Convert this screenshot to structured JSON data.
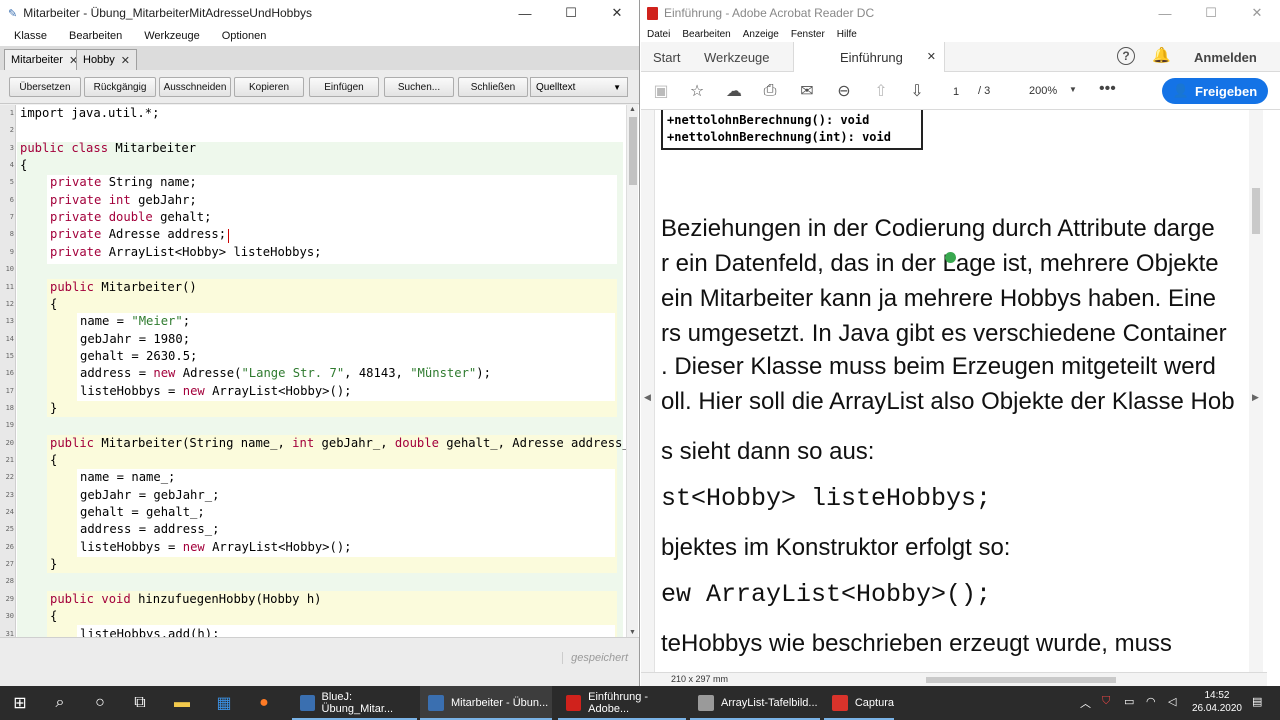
{
  "bluej": {
    "title": "Mitarbeiter - Übung_MitarbeiterMitAdresseUndHobbys",
    "menus": [
      "Klasse",
      "Bearbeiten",
      "Werkzeuge",
      "Optionen"
    ],
    "tabs": [
      {
        "label": "Mitarbeiter",
        "active": true
      },
      {
        "label": "Hobby",
        "active": false
      }
    ],
    "toolbar": {
      "compile": "Übersetzen",
      "undo": "Rückgängig",
      "cut": "Ausschneiden",
      "copy": "Kopieren",
      "paste": "Einfügen",
      "find": "Suchen...",
      "close": "Schließen",
      "view": "Quelltext"
    },
    "line_numbers": [
      "1",
      "2",
      "3",
      "4",
      "5",
      "6",
      "7",
      "8",
      "9",
      "10",
      "11",
      "12",
      "13",
      "14",
      "15",
      "16",
      "17",
      "18",
      "19",
      "20",
      "21",
      "22",
      "23",
      "24",
      "25",
      "26",
      "27",
      "28",
      "29",
      "30",
      "31"
    ],
    "code": [
      {
        "n": 1,
        "indent": 0,
        "parts": [
          {
            "t": "import java.util.*;",
            "c": ""
          }
        ]
      },
      {
        "n": 3,
        "indent": 0,
        "parts": [
          {
            "t": "public class ",
            "c": "kw"
          },
          {
            "t": "Mitarbeiter",
            "c": ""
          }
        ]
      },
      {
        "n": 4,
        "indent": 0,
        "parts": [
          {
            "t": "{",
            "c": ""
          }
        ]
      },
      {
        "n": 5,
        "indent": 1,
        "parts": [
          {
            "t": "private ",
            "c": "kw"
          },
          {
            "t": "String name;",
            "c": ""
          }
        ]
      },
      {
        "n": 6,
        "indent": 1,
        "parts": [
          {
            "t": "private int ",
            "c": "kw"
          },
          {
            "t": "gebJahr;",
            "c": ""
          }
        ]
      },
      {
        "n": 7,
        "indent": 1,
        "parts": [
          {
            "t": "private double ",
            "c": "kw"
          },
          {
            "t": "gehalt;",
            "c": ""
          }
        ]
      },
      {
        "n": 8,
        "indent": 1,
        "parts": [
          {
            "t": "private ",
            "c": "kw"
          },
          {
            "t": "Adresse address;",
            "c": ""
          }
        ]
      },
      {
        "n": 9,
        "indent": 1,
        "parts": [
          {
            "t": "private ",
            "c": "kw"
          },
          {
            "t": "ArrayList<Hobby> listeHobbys;",
            "c": ""
          }
        ]
      },
      {
        "n": 11,
        "indent": 1,
        "parts": [
          {
            "t": "public ",
            "c": "kw"
          },
          {
            "t": "Mitarbeiter()",
            "c": ""
          }
        ]
      },
      {
        "n": 12,
        "indent": 1,
        "parts": [
          {
            "t": "{",
            "c": ""
          }
        ]
      },
      {
        "n": 13,
        "indent": 2,
        "parts": [
          {
            "t": "name = ",
            "c": ""
          },
          {
            "t": "\"Meier\"",
            "c": "str"
          },
          {
            "t": ";",
            "c": ""
          }
        ]
      },
      {
        "n": 14,
        "indent": 2,
        "parts": [
          {
            "t": "gebJahr = 1980;",
            "c": ""
          }
        ]
      },
      {
        "n": 15,
        "indent": 2,
        "parts": [
          {
            "t": "gehalt = 2630.5;",
            "c": ""
          }
        ]
      },
      {
        "n": 16,
        "indent": 2,
        "parts": [
          {
            "t": "address = ",
            "c": ""
          },
          {
            "t": "new ",
            "c": "kw"
          },
          {
            "t": "Adresse(",
            "c": ""
          },
          {
            "t": "\"Lange Str. 7\"",
            "c": "str"
          },
          {
            "t": ", 48143, ",
            "c": ""
          },
          {
            "t": "\"Münster\"",
            "c": "str"
          },
          {
            "t": ");",
            "c": ""
          }
        ]
      },
      {
        "n": 17,
        "indent": 2,
        "parts": [
          {
            "t": "listeHobbys = ",
            "c": ""
          },
          {
            "t": "new ",
            "c": "kw"
          },
          {
            "t": "ArrayList<Hobby>();",
            "c": ""
          }
        ]
      },
      {
        "n": 18,
        "indent": 1,
        "parts": [
          {
            "t": "}",
            "c": ""
          }
        ]
      },
      {
        "n": 20,
        "indent": 1,
        "parts": [
          {
            "t": "public ",
            "c": "kw"
          },
          {
            "t": "Mitarbeiter(String name_, ",
            "c": ""
          },
          {
            "t": "int ",
            "c": "kw"
          },
          {
            "t": "gebJahr_, ",
            "c": ""
          },
          {
            "t": "double ",
            "c": "kw"
          },
          {
            "t": "gehalt_, Adresse address_",
            "c": ""
          }
        ]
      },
      {
        "n": 21,
        "indent": 1,
        "parts": [
          {
            "t": "{",
            "c": ""
          }
        ]
      },
      {
        "n": 22,
        "indent": 2,
        "parts": [
          {
            "t": "name = name_;",
            "c": ""
          }
        ]
      },
      {
        "n": 23,
        "indent": 2,
        "parts": [
          {
            "t": "gebJahr = gebJahr_;",
            "c": ""
          }
        ]
      },
      {
        "n": 24,
        "indent": 2,
        "parts": [
          {
            "t": "gehalt = gehalt_;",
            "c": ""
          }
        ]
      },
      {
        "n": 25,
        "indent": 2,
        "parts": [
          {
            "t": "address = address_;",
            "c": ""
          }
        ]
      },
      {
        "n": 26,
        "indent": 2,
        "parts": [
          {
            "t": "listeHobbys = ",
            "c": ""
          },
          {
            "t": "new ",
            "c": "kw"
          },
          {
            "t": "ArrayList<Hobby>();",
            "c": ""
          }
        ]
      },
      {
        "n": 27,
        "indent": 1,
        "parts": [
          {
            "t": "}",
            "c": ""
          }
        ]
      },
      {
        "n": 29,
        "indent": 1,
        "parts": [
          {
            "t": "public void ",
            "c": "kw"
          },
          {
            "t": "hinzufuegenHobby(Hobby h)",
            "c": ""
          }
        ]
      },
      {
        "n": 30,
        "indent": 1,
        "parts": [
          {
            "t": "{",
            "c": ""
          }
        ]
      },
      {
        "n": 31,
        "indent": 2,
        "parts": [
          {
            "t": "listeHobbys.add(h);",
            "c": ""
          }
        ]
      }
    ],
    "status": "gespeichert"
  },
  "acrobat": {
    "title": "Einführung - Adobe Acrobat Reader DC",
    "menus": [
      "Datei",
      "Bearbeiten",
      "Anzeige",
      "Fenster",
      "Hilfe"
    ],
    "tabs": {
      "start": "Start",
      "tools": "Werkzeuge",
      "doc": "Einführung"
    },
    "signin": "Anmelden",
    "page_current": "1",
    "page_total": "/ 3",
    "zoom": "200%",
    "share": "Freigeben",
    "uml": [
      "+nettolohnBerechnung(): void",
      "+nettolohnBerechnung(int): void"
    ],
    "lines": [
      {
        "text": "Beziehungen in der Codierung durch Attribute darge",
        "mono": false
      },
      {
        "text": "r ein Datenfeld, das in der Lage ist, mehrere Objekte",
        "mono": false
      },
      {
        "text": "ein Mitarbeiter kann ja mehrere Hobbys haben. Eine",
        "mono": false
      },
      {
        "text": "rs umgesetzt. In Java gibt es verschiedene Container",
        "mono": false
      },
      {
        "text": ". Dieser Klasse muss beim Erzeugen mitgeteilt werd",
        "mono": false
      },
      {
        "text": "oll. Hier soll die ArrayList also Objekte der Klasse Hob",
        "mono": false
      },
      {
        "text": "s sieht dann so aus:",
        "mono": false
      },
      {
        "text": "st<Hobby> listeHobbys;",
        "mono": true
      },
      {
        "text": "bjektes im Konstruktor erfolgt so:",
        "mono": false
      },
      {
        "text": "ew ArrayList<Hobby>();",
        "mono": true
      },
      {
        "text": "teHobbys wie beschrieben erzeugt wurde, muss",
        "mono": false
      }
    ],
    "page_size": "210 x 297 mm"
  },
  "taskbar": {
    "apps": [
      {
        "label": "BlueJ: Übung_Mitar...",
        "active": false,
        "color": "#3a6fb0"
      },
      {
        "label": "Mitarbeiter - Übun...",
        "active": true,
        "color": "#3a6fb0"
      },
      {
        "label": "Einführung - Adobe...",
        "active": false,
        "color": "#d0221c"
      },
      {
        "label": "ArrayList-Tafelbild...",
        "active": false,
        "color": "#9a9a9a"
      },
      {
        "label": "Captura",
        "active": false,
        "color": "#d9332b"
      }
    ],
    "time": "14:52",
    "date": "26.04.2020"
  }
}
